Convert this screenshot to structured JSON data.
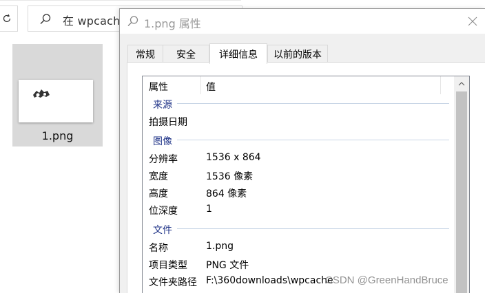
{
  "explorer": {
    "search_placeholder": "在 wpcache",
    "file_name": "1.png"
  },
  "dialog": {
    "title": "1.png 属性",
    "tabs": [
      "常规",
      "安全",
      "详细信息",
      "以前的版本"
    ],
    "active_tab": "详细信息",
    "columns": {
      "property": "属性",
      "value": "值"
    },
    "groups": {
      "origin": {
        "label": "来源",
        "rows": [
          {
            "name": "拍摄日期",
            "value": ""
          }
        ]
      },
      "image": {
        "label": "图像",
        "rows": [
          {
            "name": "分辨率",
            "value": "1536 x 864"
          },
          {
            "name": "宽度",
            "value": "1536 像素"
          },
          {
            "name": "高度",
            "value": "864 像素"
          },
          {
            "name": "位深度",
            "value": "1"
          }
        ]
      },
      "file": {
        "label": "文件",
        "rows": [
          {
            "name": "名称",
            "value": "1.png"
          },
          {
            "name": "项目类型",
            "value": "PNG 文件"
          },
          {
            "name": "文件夹路径",
            "value": "F:\\360downloads\\wpcache"
          }
        ]
      }
    }
  },
  "watermark": "CSDN @GreenHandBruce",
  "colors": {
    "group_label": "#1e3287",
    "selected_tile": "#d9d9d9",
    "dialog_bg": "#f0f0f0"
  }
}
